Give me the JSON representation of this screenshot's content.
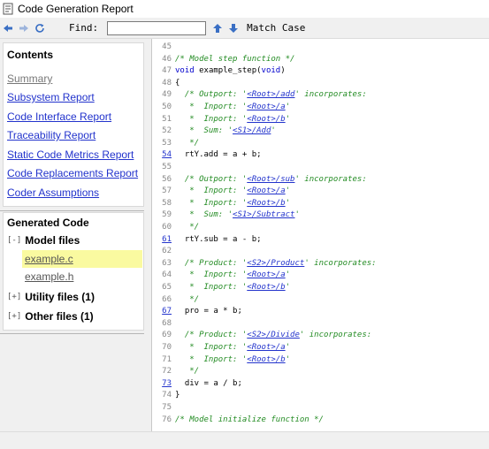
{
  "window": {
    "title": "Code Generation Report"
  },
  "toolbar": {
    "find_label": "Find:",
    "find_value": "",
    "match_case_label": "Match Case",
    "icons": [
      "back-arrow-icon",
      "forward-arrow-icon",
      "refresh-icon",
      "find-previous-icon",
      "find-next-icon"
    ]
  },
  "contents": {
    "heading": "Contents",
    "links": [
      "Summary",
      "Subsystem Report",
      "Code Interface Report",
      "Traceability Report",
      "Static Code Metrics Report",
      "Code Replacements Report",
      "Coder Assumptions"
    ]
  },
  "generated_code": {
    "heading": "Generated Code",
    "model_files": {
      "toggle": "[-]",
      "label": "Model files",
      "files": [
        "example.c",
        "example.h"
      ]
    },
    "utility_files": {
      "toggle": "[+]",
      "label": "Utility files (1)"
    },
    "other_files": {
      "toggle": "[+]",
      "label": "Other files (1)"
    }
  },
  "code": {
    "lines": [
      {
        "n": "45",
        "linked": false,
        "parts": []
      },
      {
        "n": "46",
        "linked": false,
        "parts": [
          {
            "t": "/* Model step function */",
            "c": "cm"
          }
        ]
      },
      {
        "n": "47",
        "linked": false,
        "parts": [
          {
            "t": "void",
            "c": "kw"
          },
          {
            "t": " example_step(",
            "c": "tx"
          },
          {
            "t": "void",
            "c": "kw"
          },
          {
            "t": ")",
            "c": "tx"
          }
        ]
      },
      {
        "n": "48",
        "linked": false,
        "parts": [
          {
            "t": "{",
            "c": "tx"
          }
        ]
      },
      {
        "n": "49",
        "linked": false,
        "parts": [
          {
            "t": "  /* Outport: '",
            "c": "cm"
          },
          {
            "t": "<Root>/add",
            "c": "ref"
          },
          {
            "t": "' incorporates:",
            "c": "cm"
          }
        ]
      },
      {
        "n": "50",
        "linked": false,
        "parts": [
          {
            "t": "   *  Inport: '",
            "c": "cm"
          },
          {
            "t": "<Root>/a",
            "c": "ref"
          },
          {
            "t": "'",
            "c": "cm"
          }
        ]
      },
      {
        "n": "51",
        "linked": false,
        "parts": [
          {
            "t": "   *  Inport: '",
            "c": "cm"
          },
          {
            "t": "<Root>/b",
            "c": "ref"
          },
          {
            "t": "'",
            "c": "cm"
          }
        ]
      },
      {
        "n": "52",
        "linked": false,
        "parts": [
          {
            "t": "   *  Sum: '",
            "c": "cm"
          },
          {
            "t": "<S1>/Add",
            "c": "ref"
          },
          {
            "t": "'",
            "c": "cm"
          }
        ]
      },
      {
        "n": "53",
        "linked": false,
        "parts": [
          {
            "t": "   */",
            "c": "cm"
          }
        ]
      },
      {
        "n": "54",
        "linked": true,
        "parts": [
          {
            "t": "  rtY.add = a + b;",
            "c": "tx"
          }
        ]
      },
      {
        "n": "55",
        "linked": false,
        "parts": []
      },
      {
        "n": "56",
        "linked": false,
        "parts": [
          {
            "t": "  /* Outport: '",
            "c": "cm"
          },
          {
            "t": "<Root>/sub",
            "c": "ref"
          },
          {
            "t": "' incorporates:",
            "c": "cm"
          }
        ]
      },
      {
        "n": "57",
        "linked": false,
        "parts": [
          {
            "t": "   *  Inport: '",
            "c": "cm"
          },
          {
            "t": "<Root>/a",
            "c": "ref"
          },
          {
            "t": "'",
            "c": "cm"
          }
        ]
      },
      {
        "n": "58",
        "linked": false,
        "parts": [
          {
            "t": "   *  Inport: '",
            "c": "cm"
          },
          {
            "t": "<Root>/b",
            "c": "ref"
          },
          {
            "t": "'",
            "c": "cm"
          }
        ]
      },
      {
        "n": "59",
        "linked": false,
        "parts": [
          {
            "t": "   *  Sum: '",
            "c": "cm"
          },
          {
            "t": "<S1>/Subtract",
            "c": "ref"
          },
          {
            "t": "'",
            "c": "cm"
          }
        ]
      },
      {
        "n": "60",
        "linked": false,
        "parts": [
          {
            "t": "   */",
            "c": "cm"
          }
        ]
      },
      {
        "n": "61",
        "linked": true,
        "parts": [
          {
            "t": "  rtY.sub = a - b;",
            "c": "tx"
          }
        ]
      },
      {
        "n": "62",
        "linked": false,
        "parts": []
      },
      {
        "n": "63",
        "linked": false,
        "parts": [
          {
            "t": "  /* Product: '",
            "c": "cm"
          },
          {
            "t": "<S2>/Product",
            "c": "ref"
          },
          {
            "t": "' incorporates:",
            "c": "cm"
          }
        ]
      },
      {
        "n": "64",
        "linked": false,
        "parts": [
          {
            "t": "   *  Inport: '",
            "c": "cm"
          },
          {
            "t": "<Root>/a",
            "c": "ref"
          },
          {
            "t": "'",
            "c": "cm"
          }
        ]
      },
      {
        "n": "65",
        "linked": false,
        "parts": [
          {
            "t": "   *  Inport: '",
            "c": "cm"
          },
          {
            "t": "<Root>/b",
            "c": "ref"
          },
          {
            "t": "'",
            "c": "cm"
          }
        ]
      },
      {
        "n": "66",
        "linked": false,
        "parts": [
          {
            "t": "   */",
            "c": "cm"
          }
        ]
      },
      {
        "n": "67",
        "linked": true,
        "parts": [
          {
            "t": "  pro = a * b;",
            "c": "tx"
          }
        ]
      },
      {
        "n": "68",
        "linked": false,
        "parts": []
      },
      {
        "n": "69",
        "linked": false,
        "parts": [
          {
            "t": "  /* Product: '",
            "c": "cm"
          },
          {
            "t": "<S2>/Divide",
            "c": "ref"
          },
          {
            "t": "' incorporates:",
            "c": "cm"
          }
        ]
      },
      {
        "n": "70",
        "linked": false,
        "parts": [
          {
            "t": "   *  Inport: '",
            "c": "cm"
          },
          {
            "t": "<Root>/a",
            "c": "ref"
          },
          {
            "t": "'",
            "c": "cm"
          }
        ]
      },
      {
        "n": "71",
        "linked": false,
        "parts": [
          {
            "t": "   *  Inport: '",
            "c": "cm"
          },
          {
            "t": "<Root>/b",
            "c": "ref"
          },
          {
            "t": "'",
            "c": "cm"
          }
        ]
      },
      {
        "n": "72",
        "linked": false,
        "parts": [
          {
            "t": "   */",
            "c": "cm"
          }
        ]
      },
      {
        "n": "73",
        "linked": true,
        "parts": [
          {
            "t": "  div = a / b;",
            "c": "tx"
          }
        ]
      },
      {
        "n": "74",
        "linked": false,
        "parts": [
          {
            "t": "}",
            "c": "tx"
          }
        ]
      },
      {
        "n": "75",
        "linked": false,
        "parts": []
      },
      {
        "n": "76",
        "linked": false,
        "parts": [
          {
            "t": "/* Model initialize function */",
            "c": "cm"
          }
        ]
      }
    ]
  }
}
